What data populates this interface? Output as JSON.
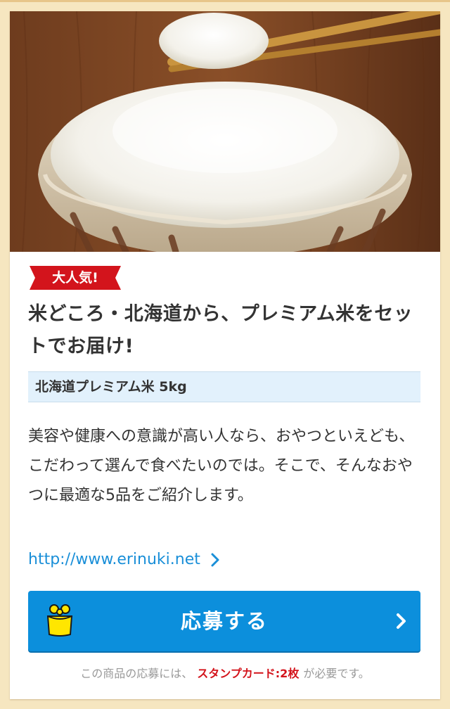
{
  "badge": {
    "label": "大人気!"
  },
  "title": "米どころ・北海道から、プレミアム米をセットでお届け!",
  "spec": "北海道プレミアム米 5kg",
  "description": "美容や健康への意識が高い人なら、おやつといえども、こだわって選んで食べたいのでは。そこで、そんなおやつに最適な5品をご紹介します。",
  "link": {
    "label": "http://www.erinuki.net",
    "icon": "chevron-right-icon"
  },
  "apply_button": {
    "label": "応募する",
    "icon": "gift-bag-icon",
    "chevron": "chevron-right-icon"
  },
  "note": {
    "prefix": "この商品の応募には、",
    "highlight": "スタンプカード:2枚",
    "suffix": "が必要です。"
  },
  "photo": {
    "alt_icon": "rice-bowl-photo"
  },
  "colors": {
    "page_bg": "#f6e6c0",
    "badge_red": "#d3141c",
    "link_blue": "#1a8fd8",
    "button_blue": "#0c8fdc",
    "spec_bg": "#e2f1fc",
    "accent_red": "#d3141c"
  }
}
